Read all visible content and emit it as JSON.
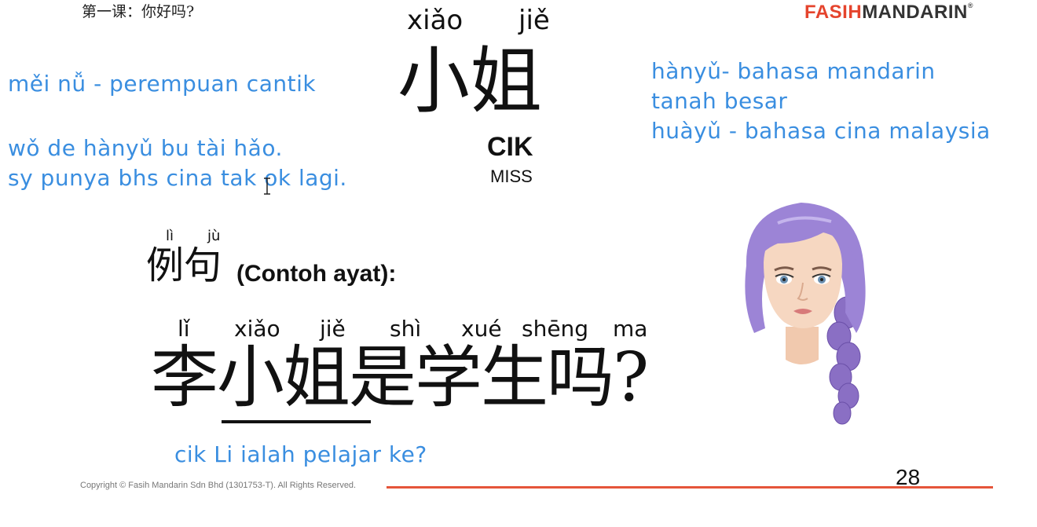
{
  "header": {
    "lesson_title": "第一课：你好吗?",
    "logo_part1": "FASIH",
    "logo_part2": "MANDARIN",
    "logo_reg": "®"
  },
  "left_notes": {
    "line1": "měi nǚ - perempuan cantik",
    "line2": "wǒ de hànyǔ bu tài hǎo.",
    "line3": "sy punya bhs cina tak ok lagi."
  },
  "right_notes": {
    "line1": "hànyǔ- bahasa mandarin",
    "line2": "tanah besar",
    "line3": "huàyǔ - bahasa cina malaysia"
  },
  "vocab": {
    "pinyin_1": "xiǎo",
    "pinyin_2": "jiě",
    "hanzi": "小姐",
    "meaning_malay": "CIK",
    "meaning_english": "MISS"
  },
  "example_heading": {
    "pinyin_1": "lì",
    "pinyin_2": "jù",
    "hanzi": "例句",
    "label": "(Contoh ayat):"
  },
  "example_sentence": {
    "pinyin": [
      "lǐ",
      "xiǎo",
      "jiě",
      "shì",
      "xué",
      "shēng",
      "ma"
    ],
    "hanzi_1": "李",
    "hanzi_2": "小姐",
    "hanzi_3": "是学生吗?",
    "translation": "cik Li ialah pelajar ke?"
  },
  "footer": {
    "copyright": "Copyright © Fasih Mandarin Sdn Bhd (1301753-T). All Rights Reserved.",
    "page_number": "28"
  },
  "icons": {
    "cursor": "text-cursor-icon",
    "illustration": "girl-with-braid-illustration"
  },
  "colors": {
    "note_blue": "#3a8ee0",
    "brand_red": "#e5442d",
    "footer_line": "#e5553a"
  }
}
